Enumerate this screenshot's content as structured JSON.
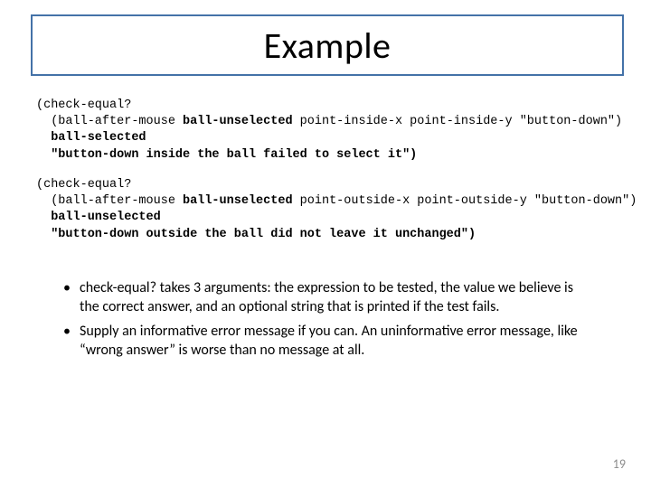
{
  "title": "Example",
  "code_block_1": {
    "l1": "(check-equal?",
    "l2a": "  (ball-after-mouse ",
    "l2b": "ball-unselected",
    "l2c": " point-inside-x point-inside-y \"button-down\")",
    "l3": "  ball-selected",
    "l4": "  \"button-down inside the ball failed to select it\")"
  },
  "code_block_2": {
    "l1": "(check-equal?",
    "l2a": "  (ball-after-mouse ",
    "l2b": "ball-unselected",
    "l2c": " point-outside-x point-outside-y \"button-down\")",
    "l3": "  ball-unselected",
    "l4": "  \"button-down outside the ball did not leave it unchanged\")"
  },
  "bullets": {
    "b1": "check-equal? takes 3 arguments:  the expression to be tested, the value we believe is the correct answer, and an optional string that is printed if the test fails.",
    "b2": "Supply an informative error message if you can.  An uninformative error message, like “wrong answer” is worse than no message at all."
  },
  "page_number": "19"
}
